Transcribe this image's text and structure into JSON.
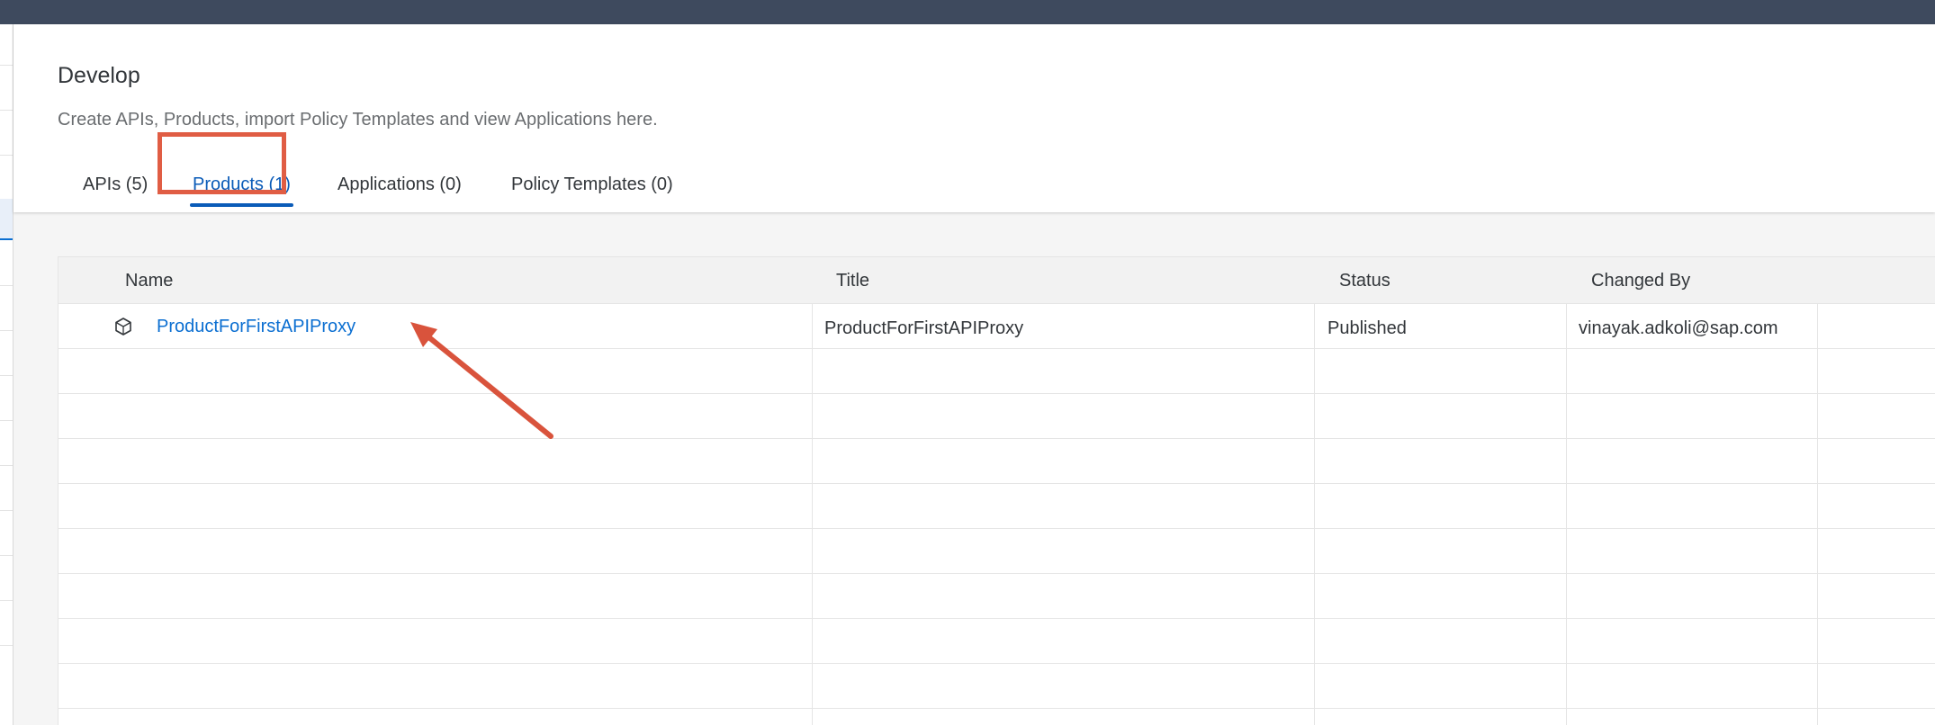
{
  "page": {
    "title": "Develop",
    "subtitle": "Create APIs, Products, import Policy Templates and view Applications here."
  },
  "tabs": [
    {
      "label": "APIs (5)",
      "active": false
    },
    {
      "label": "Products (1)",
      "active": true
    },
    {
      "label": "Applications (0)",
      "active": false
    },
    {
      "label": "Policy Templates (0)",
      "active": false
    }
  ],
  "table": {
    "columns": [
      "Name",
      "Title",
      "Status",
      "Changed By"
    ],
    "rows": [
      {
        "name": "ProductForFirstAPIProxy",
        "title": "ProductForFirstAPIProxy",
        "status": "Published",
        "changed_by": "vinayak.adkoli@sap.com",
        "icon": "product-cube-icon"
      }
    ]
  },
  "colors": {
    "shell_bar": "#3e4a5e",
    "accent": "#0a5bb8",
    "link": "#0a6ed1",
    "annotation": "#e05d44"
  }
}
